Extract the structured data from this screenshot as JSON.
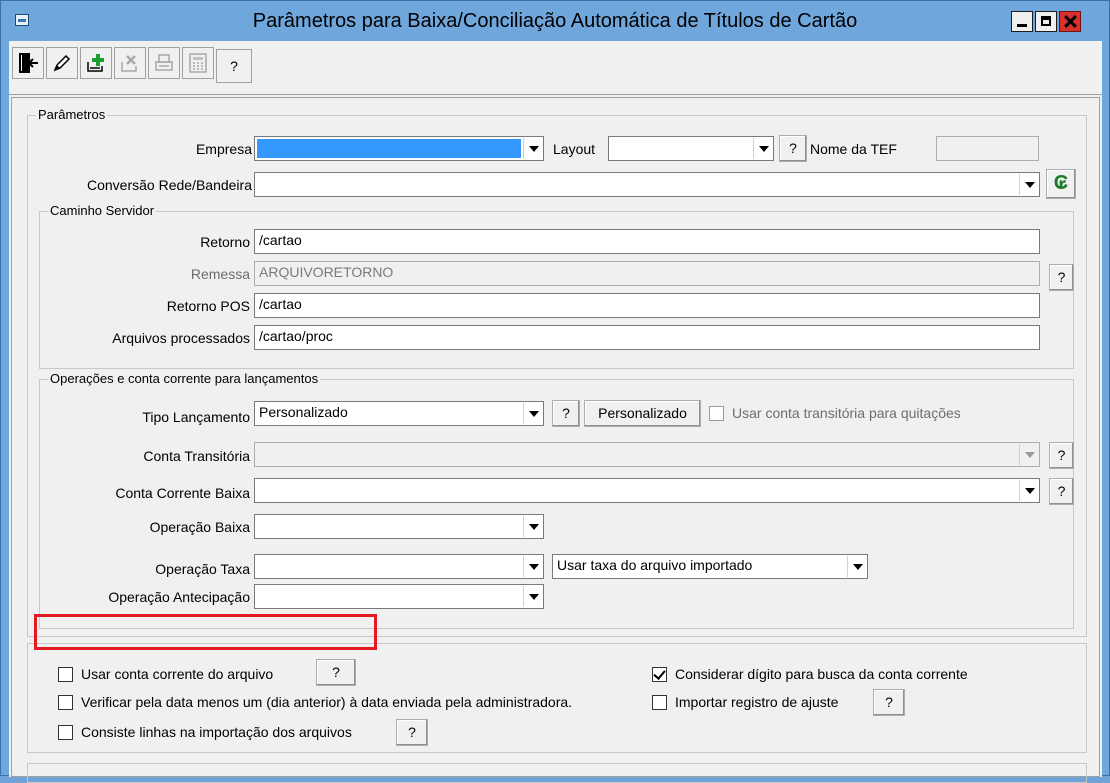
{
  "window": {
    "title": "Parâmetros para Baixa/Conciliação Automática de Títulos de Cartão"
  },
  "toolbar": {
    "buttons": [
      {
        "icon": "exit-door-icon"
      },
      {
        "icon": "edit-pencil-icon"
      },
      {
        "icon": "add-document-icon"
      },
      {
        "icon": "delete-document-icon"
      },
      {
        "icon": "print-icon"
      },
      {
        "icon": "calculator-icon"
      }
    ],
    "help_label": "?"
  },
  "parametros": {
    "title": "Parâmetros",
    "empresa_label": "Empresa",
    "empresa_value": "",
    "layout_label": "Layout",
    "layout_value": "",
    "layout_help": "?",
    "nome_tef_label": "Nome da TEF",
    "nome_tef_value": "",
    "conversao_label": "Conversão Rede/Bandeira",
    "conversao_value": ""
  },
  "caminho": {
    "title": "Caminho Servidor",
    "retorno_label": "Retorno",
    "retorno_value": "/cartao",
    "remessa_label": "Remessa",
    "remessa_value": "ARQUIVORETORNO",
    "remessa_help": "?",
    "retorno_pos_label": "Retorno POS",
    "retorno_pos_value": "/cartao",
    "arquivos_label": "Arquivos processados",
    "arquivos_value": "/cartao/proc"
  },
  "operacoes": {
    "title": "Operações e conta corrente para lançamentos",
    "tipo_label": "Tipo Lançamento",
    "tipo_value": "Personalizado",
    "tipo_help": "?",
    "personalizado_button": "Personalizado",
    "usar_transitoria_label": "Usar conta transitória para quitações",
    "conta_transitoria_label": "Conta Transitória",
    "conta_transitoria_help": "?",
    "conta_corrente_label": "Conta Corrente Baixa",
    "conta_corrente_help": "?",
    "operacao_baixa_label": "Operação Baixa",
    "operacao_taxa_label": "Operação Taxa",
    "taxa_option_value": "Usar taxa do arquivo importado",
    "operacao_antecipacao_label": "Operação Antecipação"
  },
  "options": {
    "usar_conta_label": "Usar conta corrente do arquivo",
    "usar_conta_help": "?",
    "usar_conta_checked": false,
    "considerar_label": "Considerar dígito para busca da conta corrente",
    "considerar_checked": true,
    "verificar_label": "Verificar pela data menos um (dia anterior) à data enviada pela administradora.",
    "verificar_checked": false,
    "importar_label": "Importar registro de ajuste",
    "importar_help": "?",
    "importar_checked": false,
    "consiste_label": "Consiste linhas na importação dos arquivos",
    "consiste_help": "?",
    "consiste_checked": false
  }
}
